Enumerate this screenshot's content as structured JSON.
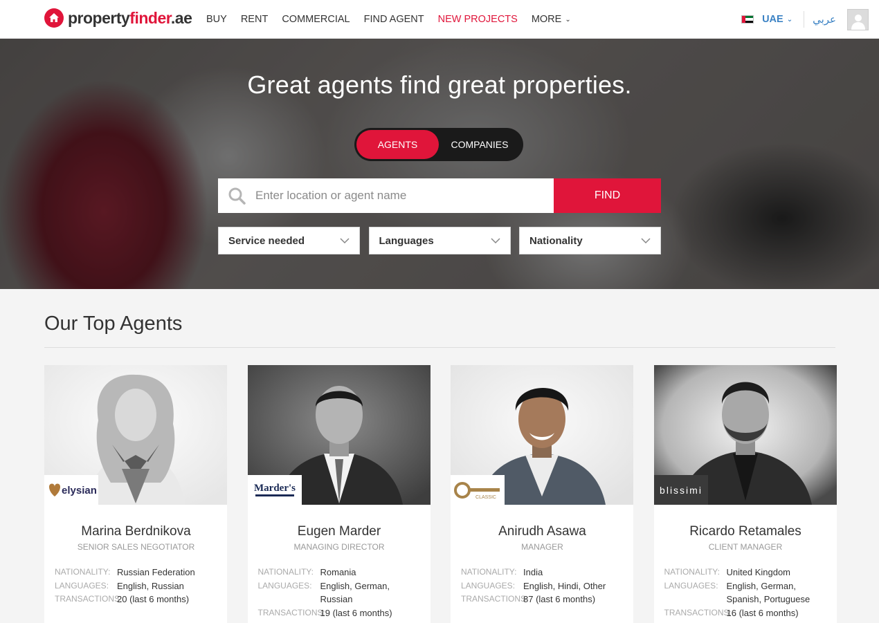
{
  "header": {
    "logo": {
      "part1": "property",
      "part2": "finder",
      "part3": ".ae"
    },
    "nav": [
      {
        "label": "BUY"
      },
      {
        "label": "RENT"
      },
      {
        "label": "COMMERCIAL"
      },
      {
        "label": "FIND AGENT"
      },
      {
        "label": "NEW PROJECTS",
        "highlight": true
      },
      {
        "label": "MORE"
      }
    ],
    "country": "UAE",
    "language": "عربي"
  },
  "hero": {
    "title": "Great agents find great properties.",
    "tabs": {
      "active": "AGENTS",
      "inactive": "COMPANIES"
    },
    "search": {
      "placeholder": "Enter location or agent name",
      "value": "",
      "button": "FIND"
    },
    "filters": [
      "Service needed",
      "Languages",
      "Nationality"
    ]
  },
  "section": {
    "title": "Our Top Agents"
  },
  "labels": {
    "nationality": "NATIONALITY:",
    "languages": "LANGUAGES:",
    "transactions": "TRANSACTIONS:"
  },
  "agents": [
    {
      "name": "Marina Berdnikova",
      "title": "SENIOR SALES NEGOTIATOR",
      "nationality": "Russian Federation",
      "languages": "English, Russian",
      "transactions": "20  (last 6 months)",
      "company_logo": "elysian"
    },
    {
      "name": "Eugen Marder",
      "title": "MANAGING DIRECTOR",
      "nationality": "Romania",
      "languages": "English, German, Russian",
      "transactions": "19  (last 6 months)",
      "company_logo": "Marder's"
    },
    {
      "name": "Anirudh Asawa",
      "title": "MANAGER",
      "nationality": "India",
      "languages": "English, Hindi, Other",
      "transactions": "87  (last 6 months)",
      "company_logo": "CLASSIC"
    },
    {
      "name": "Ricardo Retamales",
      "title": "CLIENT MANAGER",
      "nationality": "United Kingdom",
      "languages": "English, German, Spanish, Portuguese",
      "transactions": "16  (last 6 months)",
      "company_logo": "blissimi"
    }
  ],
  "colors": {
    "brand_red": "#e0153a",
    "link_blue": "#3b82c4"
  },
  "icons": {
    "logo": "house-icon",
    "search": "search-icon",
    "chevron": "chevron-down-icon",
    "user": "user-icon",
    "flag": "uae-flag-icon"
  }
}
